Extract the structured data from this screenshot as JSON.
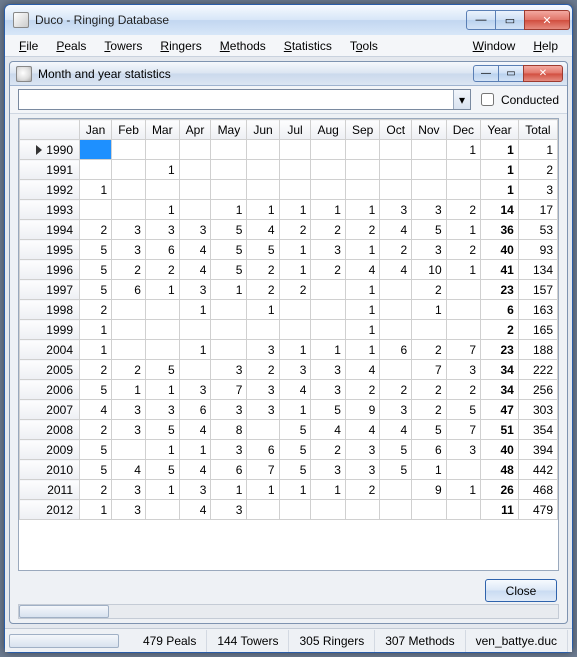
{
  "window": {
    "title": "Duco - Ringing Database"
  },
  "menu": {
    "file": "File",
    "peals": "Peals",
    "towers": "Towers",
    "ringers": "Ringers",
    "methods": "Methods",
    "statistics": "Statistics",
    "tools": "Tools",
    "window": "Window",
    "help": "Help"
  },
  "child": {
    "title": "Month and year statistics",
    "combo_value": "",
    "conducted_label": "Conducted",
    "close_label": "Close"
  },
  "grid": {
    "columns": [
      "Jan",
      "Feb",
      "Mar",
      "Apr",
      "May",
      "Jun",
      "Jul",
      "Aug",
      "Sep",
      "Oct",
      "Nov",
      "Dec",
      "Year",
      "Total"
    ],
    "rows": [
      {
        "year": "1990",
        "cells": [
          "",
          "",
          "",
          "",
          "",
          "",
          "",
          "",
          "",
          "",
          "",
          "1",
          "1",
          "1"
        ],
        "active": true,
        "selcol": 0
      },
      {
        "year": "1991",
        "cells": [
          "",
          "",
          "1",
          "",
          "",
          "",
          "",
          "",
          "",
          "",
          "",
          "",
          "1",
          "2"
        ]
      },
      {
        "year": "1992",
        "cells": [
          "1",
          "",
          "",
          "",
          "",
          "",
          "",
          "",
          "",
          "",
          "",
          "",
          "1",
          "3"
        ]
      },
      {
        "year": "1993",
        "cells": [
          "",
          "",
          "1",
          "",
          "1",
          "1",
          "1",
          "1",
          "1",
          "3",
          "3",
          "2",
          "14",
          "17"
        ]
      },
      {
        "year": "1994",
        "cells": [
          "2",
          "3",
          "3",
          "3",
          "5",
          "4",
          "2",
          "2",
          "2",
          "4",
          "5",
          "1",
          "36",
          "53"
        ]
      },
      {
        "year": "1995",
        "cells": [
          "5",
          "3",
          "6",
          "4",
          "5",
          "5",
          "1",
          "3",
          "1",
          "2",
          "3",
          "2",
          "40",
          "93"
        ]
      },
      {
        "year": "1996",
        "cells": [
          "5",
          "2",
          "2",
          "4",
          "5",
          "2",
          "1",
          "2",
          "4",
          "4",
          "10",
          "1",
          "41",
          "134"
        ]
      },
      {
        "year": "1997",
        "cells": [
          "5",
          "6",
          "1",
          "3",
          "1",
          "2",
          "2",
          "",
          "1",
          "",
          "2",
          "",
          "23",
          "157"
        ]
      },
      {
        "year": "1998",
        "cells": [
          "2",
          "",
          "",
          "1",
          "",
          "1",
          "",
          "",
          "1",
          "",
          "1",
          "",
          "6",
          "163"
        ]
      },
      {
        "year": "1999",
        "cells": [
          "1",
          "",
          "",
          "",
          "",
          "",
          "",
          "",
          "1",
          "",
          "",
          "",
          "2",
          "165"
        ]
      },
      {
        "year": "2004",
        "cells": [
          "1",
          "",
          "",
          "1",
          "",
          "3",
          "1",
          "1",
          "1",
          "6",
          "2",
          "7",
          "23",
          "188"
        ]
      },
      {
        "year": "2005",
        "cells": [
          "2",
          "2",
          "5",
          "",
          "3",
          "2",
          "3",
          "3",
          "4",
          "",
          "7",
          "3",
          "34",
          "222"
        ]
      },
      {
        "year": "2006",
        "cells": [
          "5",
          "1",
          "1",
          "3",
          "7",
          "3",
          "4",
          "3",
          "2",
          "2",
          "2",
          "2",
          "34",
          "256"
        ]
      },
      {
        "year": "2007",
        "cells": [
          "4",
          "3",
          "3",
          "6",
          "3",
          "3",
          "1",
          "5",
          "9",
          "3",
          "2",
          "5",
          "47",
          "303"
        ]
      },
      {
        "year": "2008",
        "cells": [
          "2",
          "3",
          "5",
          "4",
          "8",
          "",
          "5",
          "4",
          "4",
          "4",
          "5",
          "7",
          "51",
          "354"
        ]
      },
      {
        "year": "2009",
        "cells": [
          "5",
          "",
          "1",
          "1",
          "3",
          "6",
          "5",
          "2",
          "3",
          "5",
          "6",
          "3",
          "40",
          "394"
        ]
      },
      {
        "year": "2010",
        "cells": [
          "5",
          "4",
          "5",
          "4",
          "6",
          "7",
          "5",
          "3",
          "3",
          "5",
          "1",
          "",
          "48",
          "442"
        ]
      },
      {
        "year": "2011",
        "cells": [
          "2",
          "3",
          "1",
          "3",
          "1",
          "1",
          "1",
          "1",
          "2",
          "",
          "9",
          "1",
          "26",
          "468"
        ]
      },
      {
        "year": "2012",
        "cells": [
          "1",
          "3",
          "",
          "4",
          "3",
          "",
          "",
          "",
          "",
          "",
          "",
          "",
          "11",
          "479"
        ]
      }
    ]
  },
  "status": {
    "peals": "479 Peals",
    "towers": "144 Towers",
    "ringers": "305 Ringers",
    "methods": "307 Methods",
    "file": "ven_battye.duc"
  }
}
